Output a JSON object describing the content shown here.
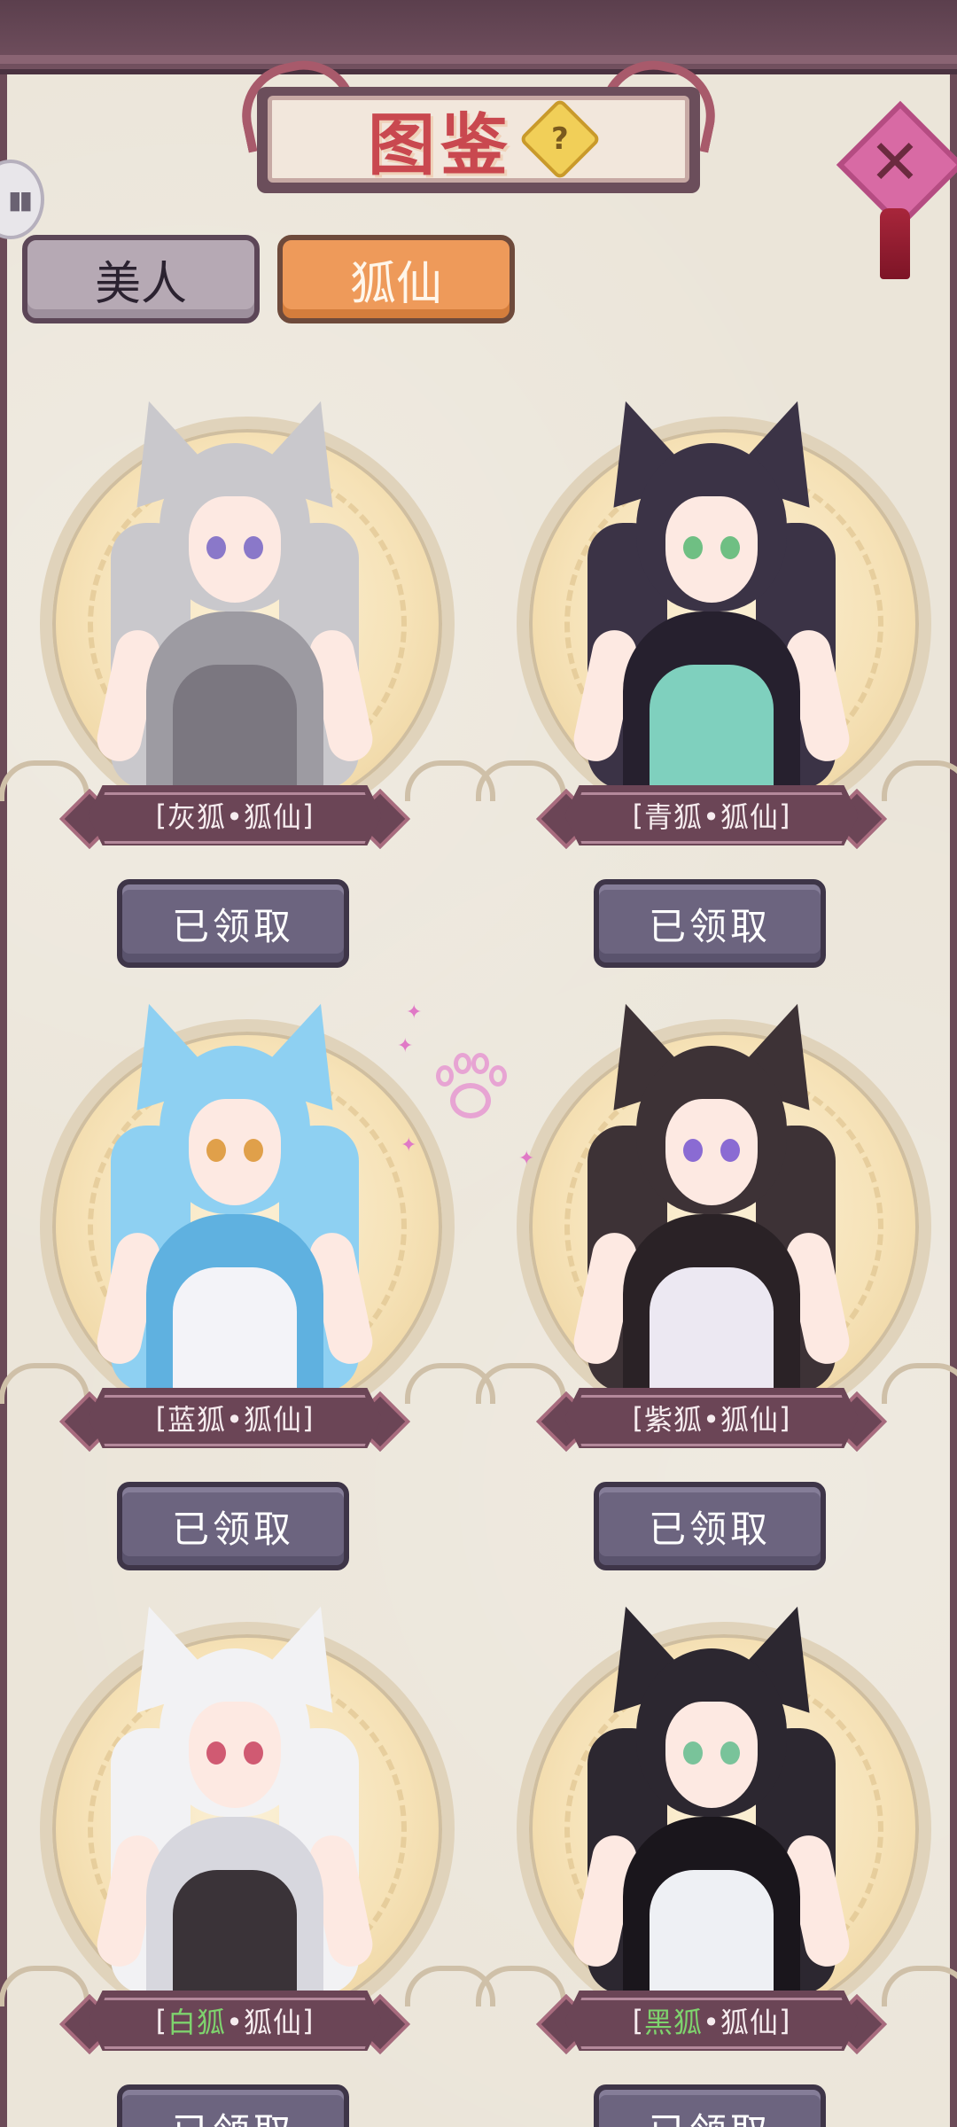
{
  "header": {
    "title": "图鉴",
    "help_icon": "?",
    "close_icon": "✕"
  },
  "tabs": [
    {
      "label": "美人",
      "active": false
    },
    {
      "label": "狐仙",
      "active": true
    }
  ],
  "cards": [
    {
      "prefix": "[",
      "name_a": "灰狐",
      "name_b": "•狐仙",
      "suffix": "]",
      "button": "已领取",
      "highlight": false,
      "hair": "#c9c8cc",
      "hair_dark": "#9d9ba2",
      "eye": "#8a78c9",
      "dress": "#7b7780",
      "ear_inner": "#f0b9c6"
    },
    {
      "prefix": "[",
      "name_a": "青狐",
      "name_b": "•狐仙",
      "suffix": "]",
      "button": "已领取",
      "highlight": false,
      "hair": "#3b3346",
      "hair_dark": "#26202e",
      "eye": "#6fbf83",
      "dress": "#7fd0be",
      "ear_inner": "#f0b9c6"
    },
    {
      "prefix": "[",
      "name_a": "蓝狐",
      "name_b": "•狐仙",
      "suffix": "]",
      "button": "已领取",
      "highlight": false,
      "hair": "#8ed0f2",
      "hair_dark": "#5fb1e0",
      "eye": "#e0a04a",
      "dress": "#f3f3f8",
      "ear_inner": "#c7e9fb"
    },
    {
      "prefix": "[",
      "name_a": "紫狐",
      "name_b": "•狐仙",
      "suffix": "]",
      "button": "已领取",
      "highlight": false,
      "hair": "#3d3236",
      "hair_dark": "#2a2226",
      "eye": "#8a6bd3",
      "dress": "#ece8f2",
      "ear_inner": "#f2b8c4"
    },
    {
      "prefix": "[",
      "name_a": "白狐",
      "name_b": "•狐仙",
      "suffix": "]",
      "button": "已领取",
      "highlight": true,
      "hair": "#f2f2f4",
      "hair_dark": "#d7d7de",
      "eye": "#d05a72",
      "dress": "#3a3338",
      "ear_inner": "#f2c9cf"
    },
    {
      "prefix": "[",
      "name_a": "黑狐",
      "name_b": "•狐仙",
      "suffix": "]",
      "button": "已领取",
      "highlight": true,
      "hair": "#2c2730",
      "hair_dark": "#1a161c",
      "eye": "#79c39a",
      "dress": "#eef0f4",
      "ear_inner": "#f0b9c6"
    }
  ],
  "side_handle": "▮▮",
  "colors": {
    "accent_tab": "#ee9a5a",
    "inactive_tab": "#b6a9b4",
    "claim_button": "#6c647f",
    "banner": "#6b4556",
    "title_red": "#c9484f",
    "name_green": "#7ed36d"
  }
}
